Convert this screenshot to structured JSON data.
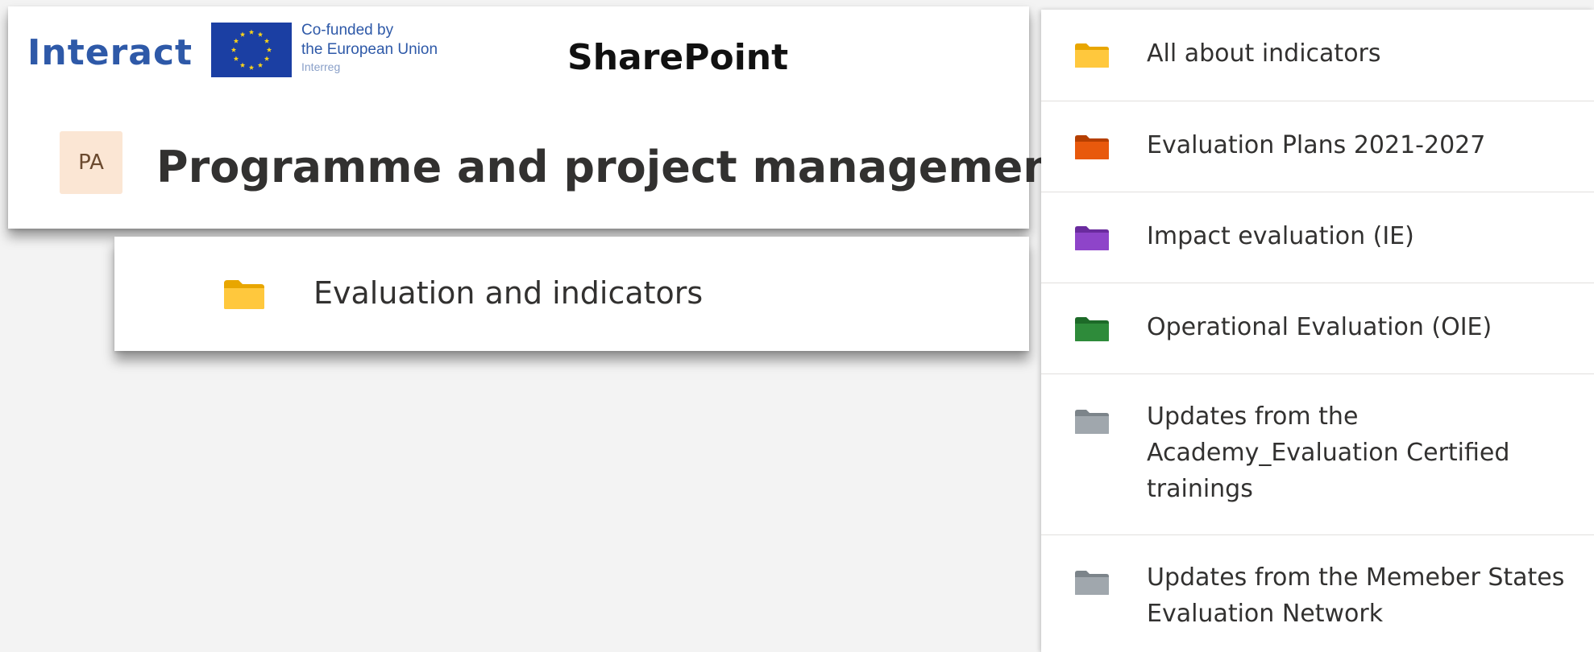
{
  "header": {
    "brand_name": "Interact",
    "eu_funding_line1": "Co-funded by",
    "eu_funding_line2": "the European Union",
    "eu_funding_line3": "Interreg",
    "app_name": "SharePoint",
    "site_initials": "PA",
    "site_title": "Programme and project management",
    "brand_color": "#2e59a8",
    "eu_flag_color": "#1b3fa3",
    "eu_star_color": "#ffd617"
  },
  "current_folder": {
    "label": "Evaluation and indicators",
    "icon": "folder-icon",
    "color": "#ffc83d"
  },
  "folder_list": [
    {
      "label": "All about indicators",
      "icon": "folder-icon",
      "color": "#ffc83d"
    },
    {
      "label": "Evaluation Plans 2021-2027",
      "icon": "folder-icon",
      "color": "#e8590c"
    },
    {
      "label": "Impact evaluation (IE)",
      "icon": "folder-icon",
      "color": "#8e44c9"
    },
    {
      "label": "Operational Evaluation (OIE)",
      "icon": "folder-icon",
      "color": "#2e8b3a"
    },
    {
      "label": "Updates from the Academy_Evaluation Certified trainings",
      "icon": "folder-icon",
      "color": "#a0a7ad"
    },
    {
      "label": "Updates from the Memeber States Evaluation Network",
      "icon": "folder-icon",
      "color": "#a0a7ad"
    }
  ]
}
